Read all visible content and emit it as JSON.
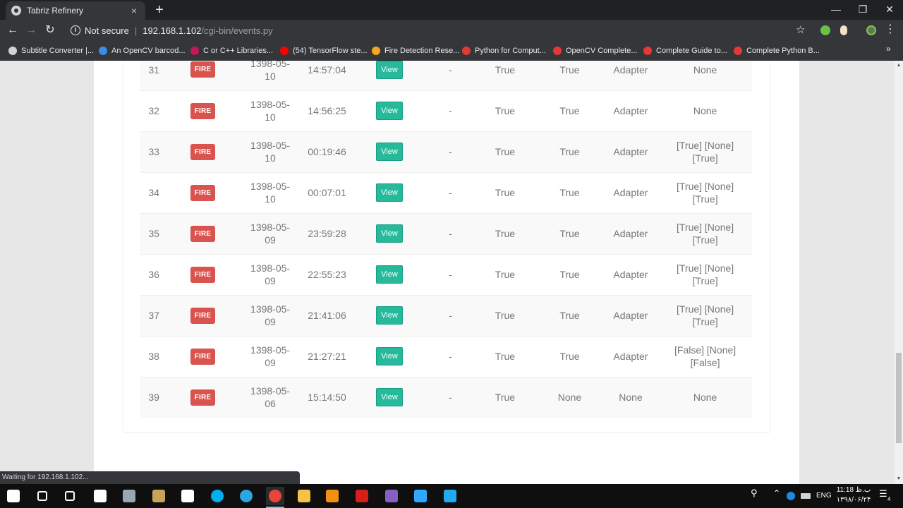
{
  "browser": {
    "tab_title": "Tabriz Refinery",
    "tab_close": "×",
    "new_tab": "+",
    "window_minimize": "—",
    "window_restore": "❐",
    "window_close": "✕",
    "security_label": "Not secure",
    "url_host": "192.168.1.102",
    "url_path": "/cgi-bin/events.py",
    "status_text": "Waiting for 192.168.1.102...",
    "bookmarks_more": "»"
  },
  "bookmarks": [
    {
      "label": "Subtitle Converter |...",
      "color": "#cfd2d6"
    },
    {
      "label": "An OpenCV barcod...",
      "color": "#3a8ee6"
    },
    {
      "label": "C or C++ Libraries...",
      "color": "#c2185b"
    },
    {
      "label": "(54) TensorFlow ste...",
      "color": "#ff0000"
    },
    {
      "label": "Fire Detection Rese...",
      "color": "#f5a623"
    },
    {
      "label": "Python for Comput...",
      "color": "#e53935"
    },
    {
      "label": "OpenCV Complete...",
      "color": "#e53935"
    },
    {
      "label": "Complete Guide to...",
      "color": "#e53935"
    },
    {
      "label": "Complete Python B...",
      "color": "#e53935"
    }
  ],
  "table": {
    "fire_label": "FIRE",
    "view_label": "View",
    "rows": [
      {
        "id": "31",
        "date": "1398-05-10",
        "time": "14:57:04",
        "dash": "-",
        "a": "True",
        "b": "True",
        "c": "Adapter",
        "d": "None"
      },
      {
        "id": "32",
        "date": "1398-05-10",
        "time": "14:56:25",
        "dash": "-",
        "a": "True",
        "b": "True",
        "c": "Adapter",
        "d": "None"
      },
      {
        "id": "33",
        "date": "1398-05-10",
        "time": "00:19:46",
        "dash": "-",
        "a": "True",
        "b": "True",
        "c": "Adapter",
        "d": "[True] [None] [True]"
      },
      {
        "id": "34",
        "date": "1398-05-10",
        "time": "00:07:01",
        "dash": "-",
        "a": "True",
        "b": "True",
        "c": "Adapter",
        "d": "[True] [None] [True]"
      },
      {
        "id": "35",
        "date": "1398-05-09",
        "time": "23:59:28",
        "dash": "-",
        "a": "True",
        "b": "True",
        "c": "Adapter",
        "d": "[True] [None] [True]"
      },
      {
        "id": "36",
        "date": "1398-05-09",
        "time": "22:55:23",
        "dash": "-",
        "a": "True",
        "b": "True",
        "c": "Adapter",
        "d": "[True] [None] [True]"
      },
      {
        "id": "37",
        "date": "1398-05-09",
        "time": "21:41:06",
        "dash": "-",
        "a": "True",
        "b": "True",
        "c": "Adapter",
        "d": "[True] [None] [True]"
      },
      {
        "id": "38",
        "date": "1398-05-09",
        "time": "21:27:21",
        "dash": "-",
        "a": "True",
        "b": "True",
        "c": "Adapter",
        "d": "[False] [None] [False]"
      },
      {
        "id": "39",
        "date": "1398-05-06",
        "time": "15:14:50",
        "dash": "-",
        "a": "True",
        "b": "None",
        "c": "None",
        "d": "None"
      }
    ]
  },
  "taskbar": {
    "apps": [
      {
        "name": "windows-start-icon",
        "color": "#ffffff"
      },
      {
        "name": "search-icon",
        "color": "#ffffff"
      },
      {
        "name": "task-view-icon",
        "color": "#ffffff"
      },
      {
        "name": "store-icon",
        "color": "#ffffff"
      },
      {
        "name": "app-icon",
        "color": "#9aa7b0"
      },
      {
        "name": "app-icon",
        "color": "#c8a45a"
      },
      {
        "name": "mail-icon",
        "color": "#ffffff"
      },
      {
        "name": "skype-icon",
        "color": "#00aff0"
      },
      {
        "name": "telegram-icon",
        "color": "#2ca5e0"
      },
      {
        "name": "chrome-icon",
        "color": "#e8453c"
      },
      {
        "name": "file-explorer-icon",
        "color": "#f6c344"
      },
      {
        "name": "media-player-icon",
        "color": "#f29111"
      },
      {
        "name": "acrobat-icon",
        "color": "#d4201b"
      },
      {
        "name": "visual-studio-icon",
        "color": "#865fc5"
      },
      {
        "name": "photoshop-icon",
        "color": "#31a8ff"
      },
      {
        "name": "vscode-icon",
        "color": "#23a9f2"
      }
    ],
    "language": "ENG",
    "time": "11:18 ب.ظ",
    "date": "۱۳۹۸/۰۶/۲۴",
    "notification_count": "4"
  }
}
